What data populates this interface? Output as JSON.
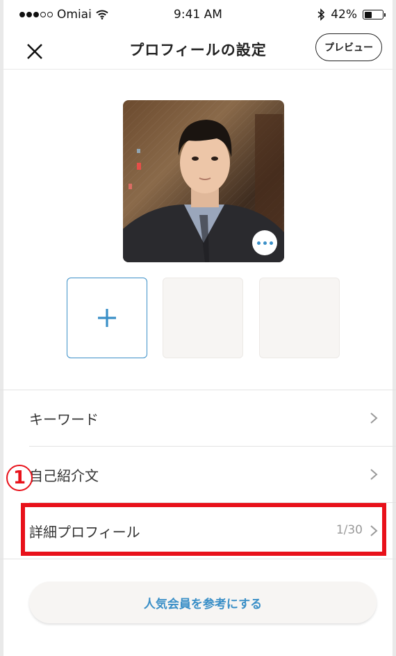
{
  "status_bar": {
    "carrier": "Omiai",
    "time": "9:41 AM",
    "battery": "42%",
    "battery_level": 0.42,
    "signal_bars_filled": 3,
    "signal_bars_total": 5
  },
  "nav": {
    "close_label": "✕",
    "title": "プロフィールの設定",
    "preview_label": "プレビュー"
  },
  "photos": {
    "add_label": "+",
    "more_icon": "more-dots-icon"
  },
  "menu": {
    "items": [
      {
        "label": "キーワード",
        "value": ""
      },
      {
        "label": "自己紹介文",
        "value": ""
      },
      {
        "label": "詳細プロフィール",
        "value": "1/30"
      }
    ]
  },
  "annotation": {
    "marker": "1",
    "color": "#e8111a"
  },
  "popular_button": {
    "label": "人気会員を参考にする"
  },
  "colors": {
    "accent": "#3a8fc7",
    "highlight": "#e8111a",
    "separator": "#e3e3e3"
  }
}
